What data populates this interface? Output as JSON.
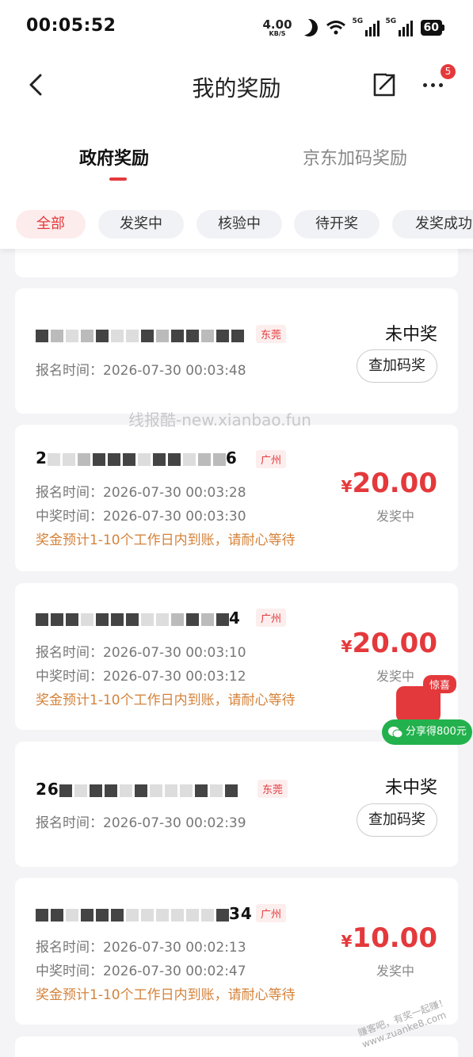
{
  "status_bar": {
    "time": "00:05:52",
    "net_speed": "4.00",
    "net_unit": "KB/S",
    "sig1": "5G",
    "sig2": "5G",
    "battery": "60"
  },
  "header": {
    "title": "我的奖励",
    "badge": "5"
  },
  "tabs": [
    {
      "label": "政府奖励"
    },
    {
      "label": "京东加码奖励"
    }
  ],
  "chips": [
    {
      "label": "全部"
    },
    {
      "label": "发奖中"
    },
    {
      "label": "核验中"
    },
    {
      "label": "待开奖"
    },
    {
      "label": "发奖成功"
    }
  ],
  "watermark": "线报酷-new.xianbao.fun",
  "watermark2": "赚客吧，有奖一起赚！www.zuanke8.com",
  "records": [
    {
      "id_prefix": "",
      "id_suffix": "",
      "city": "东莞",
      "signup": "报名时间：2026-07-30 00:03:48",
      "win": "",
      "note": "",
      "status": "未中奖",
      "button": "查加码奖"
    },
    {
      "id_prefix": "2",
      "id_suffix": "6",
      "city": "广州",
      "signup": "报名时间：2026-07-30 00:03:28",
      "win": "中奖时间：2026-07-30 00:03:30",
      "note": "奖金预计1-10个工作日内到账，请耐心等待",
      "currency": "¥",
      "amount": "20.00",
      "sub_status": "发奖中"
    },
    {
      "id_prefix": "",
      "id_suffix": "4",
      "city": "广州",
      "signup": "报名时间：2026-07-30 00:03:10",
      "win": "中奖时间：2026-07-30 00:03:12",
      "note": "奖金预计1-10个工作日内到账，请耐心等待",
      "currency": "¥",
      "amount": "20.00",
      "sub_status": "发奖中"
    },
    {
      "id_prefix": "26",
      "id_suffix": "",
      "city": "东莞",
      "signup": "报名时间：2026-07-30 00:02:39",
      "win": "",
      "note": "",
      "status": "未中奖",
      "button": "查加码奖"
    },
    {
      "id_prefix": "",
      "id_suffix": "34",
      "city": "广州",
      "signup": "报名时间：2026-07-30 00:02:13",
      "win": "中奖时间：2026-07-30 00:02:47",
      "note": "奖金预计1-10个工作日内到账，请耐心等待",
      "currency": "¥",
      "amount": "10.00",
      "sub_status": "发奖中"
    }
  ],
  "float": {
    "label": "惊喜",
    "share": "分享得800元"
  },
  "colors": {
    "accent": "#e4393c",
    "note": "#d4823a",
    "wechat": "#23b14d"
  }
}
